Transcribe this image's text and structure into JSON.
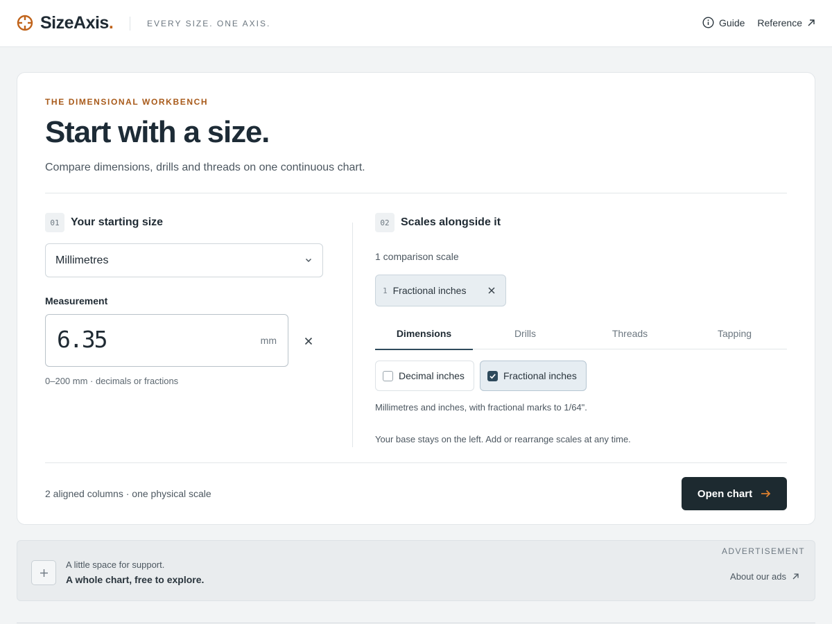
{
  "header": {
    "brand_name": "SizeAxis",
    "brand_dot": ".",
    "tagline": "EVERY SIZE. ONE AXIS.",
    "nav": [
      {
        "label": "Guide",
        "icon": "info-circle-icon"
      },
      {
        "label": "Reference",
        "icon": "arrow-up-right-icon"
      }
    ]
  },
  "hero": {
    "eyebrow": "THE DIMENSIONAL WORKBENCH",
    "title": "Start with a size.",
    "subtitle": "Compare dimensions, drills and threads on one continuous chart."
  },
  "step1": {
    "num": "01",
    "title": "Your starting size",
    "unit_select": "Millimetres",
    "measurement_label": "Measurement",
    "measurement_value": "6.35",
    "measurement_unit": "mm",
    "hint": "0–200 mm · decimals or fractions"
  },
  "step2": {
    "num": "02",
    "title": "Scales alongside it",
    "count": "1 comparison scale",
    "chip": {
      "index": "1",
      "label": "Fractional inches"
    },
    "tabs": [
      {
        "label": "Dimensions",
        "active": true
      },
      {
        "label": "Drills",
        "active": false
      },
      {
        "label": "Threads",
        "active": false
      },
      {
        "label": "Tapping",
        "active": false
      }
    ],
    "options": [
      {
        "label": "Decimal inches",
        "checked": false
      },
      {
        "label": "Fractional inches",
        "checked": true
      }
    ],
    "description": "Millimetres and inches, with fractional marks to 1/64\".",
    "note": "Your base stays on the left. Add or rearrange scales at any time."
  },
  "footer": {
    "summary": "2 aligned columns · one physical scale",
    "cta": "Open chart"
  },
  "ad": {
    "line1": "A little space for support.",
    "line2": "A whole chart, free to explore.",
    "tag": "ADVERTISEMENT",
    "link": "About our ads"
  },
  "colors": {
    "accent": "#c0631a",
    "primary_dark": "#1d2a30",
    "tab_active": "#2e4a5c"
  }
}
